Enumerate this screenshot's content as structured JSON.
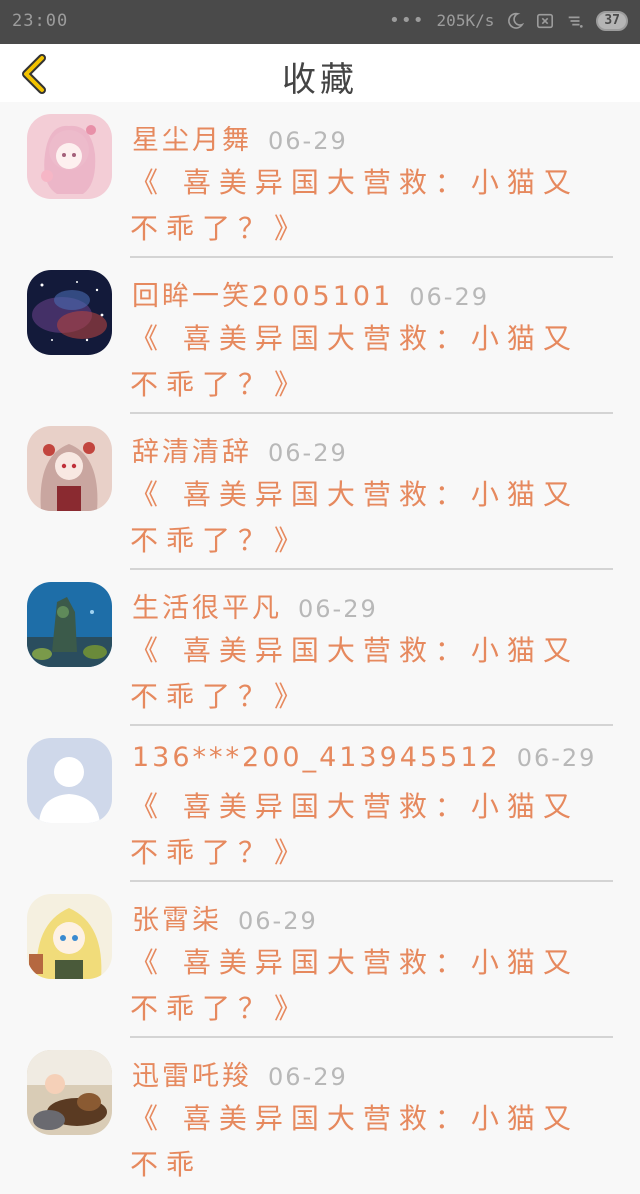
{
  "status_bar": {
    "time": "23:00",
    "dots": "•••",
    "speed": "205K/s",
    "battery": "37"
  },
  "header": {
    "title": "收藏"
  },
  "favorites": [
    {
      "user": "星尘月舞",
      "date": "06-29",
      "title": "《 喜美异国大营救：小猫又不乖了？》",
      "avatar": "pink-anime"
    },
    {
      "user": "回眸一笑2005101",
      "date": "06-29",
      "title": "《 喜美异国大营救：小猫又不乖了？》",
      "avatar": "galaxy"
    },
    {
      "user": "辞清清辞",
      "date": "06-29",
      "title": "《 喜美异国大营救：小猫又不乖了？》",
      "avatar": "red-anime"
    },
    {
      "user": "生活很平凡",
      "date": "06-29",
      "title": "《 喜美异国大营救：小猫又不乖了？》",
      "avatar": "aquarium"
    },
    {
      "user": "136***200_413945512",
      "date": "06-29",
      "title": "《 喜美异国大营救：小猫又不乖了？》",
      "avatar": "default-user"
    },
    {
      "user": "张霄柒",
      "date": "06-29",
      "title": "《 喜美异国大营救：小猫又不乖了？》",
      "avatar": "blonde-anime"
    },
    {
      "user": "迅雷吒羧",
      "date": "06-29",
      "title": "《 喜美异国大营救：小猫又不乖",
      "avatar": "baby-dog"
    }
  ],
  "colors": {
    "accent": "#e6895e",
    "date": "#b8b8b8",
    "back_icon": "#f2c200"
  }
}
